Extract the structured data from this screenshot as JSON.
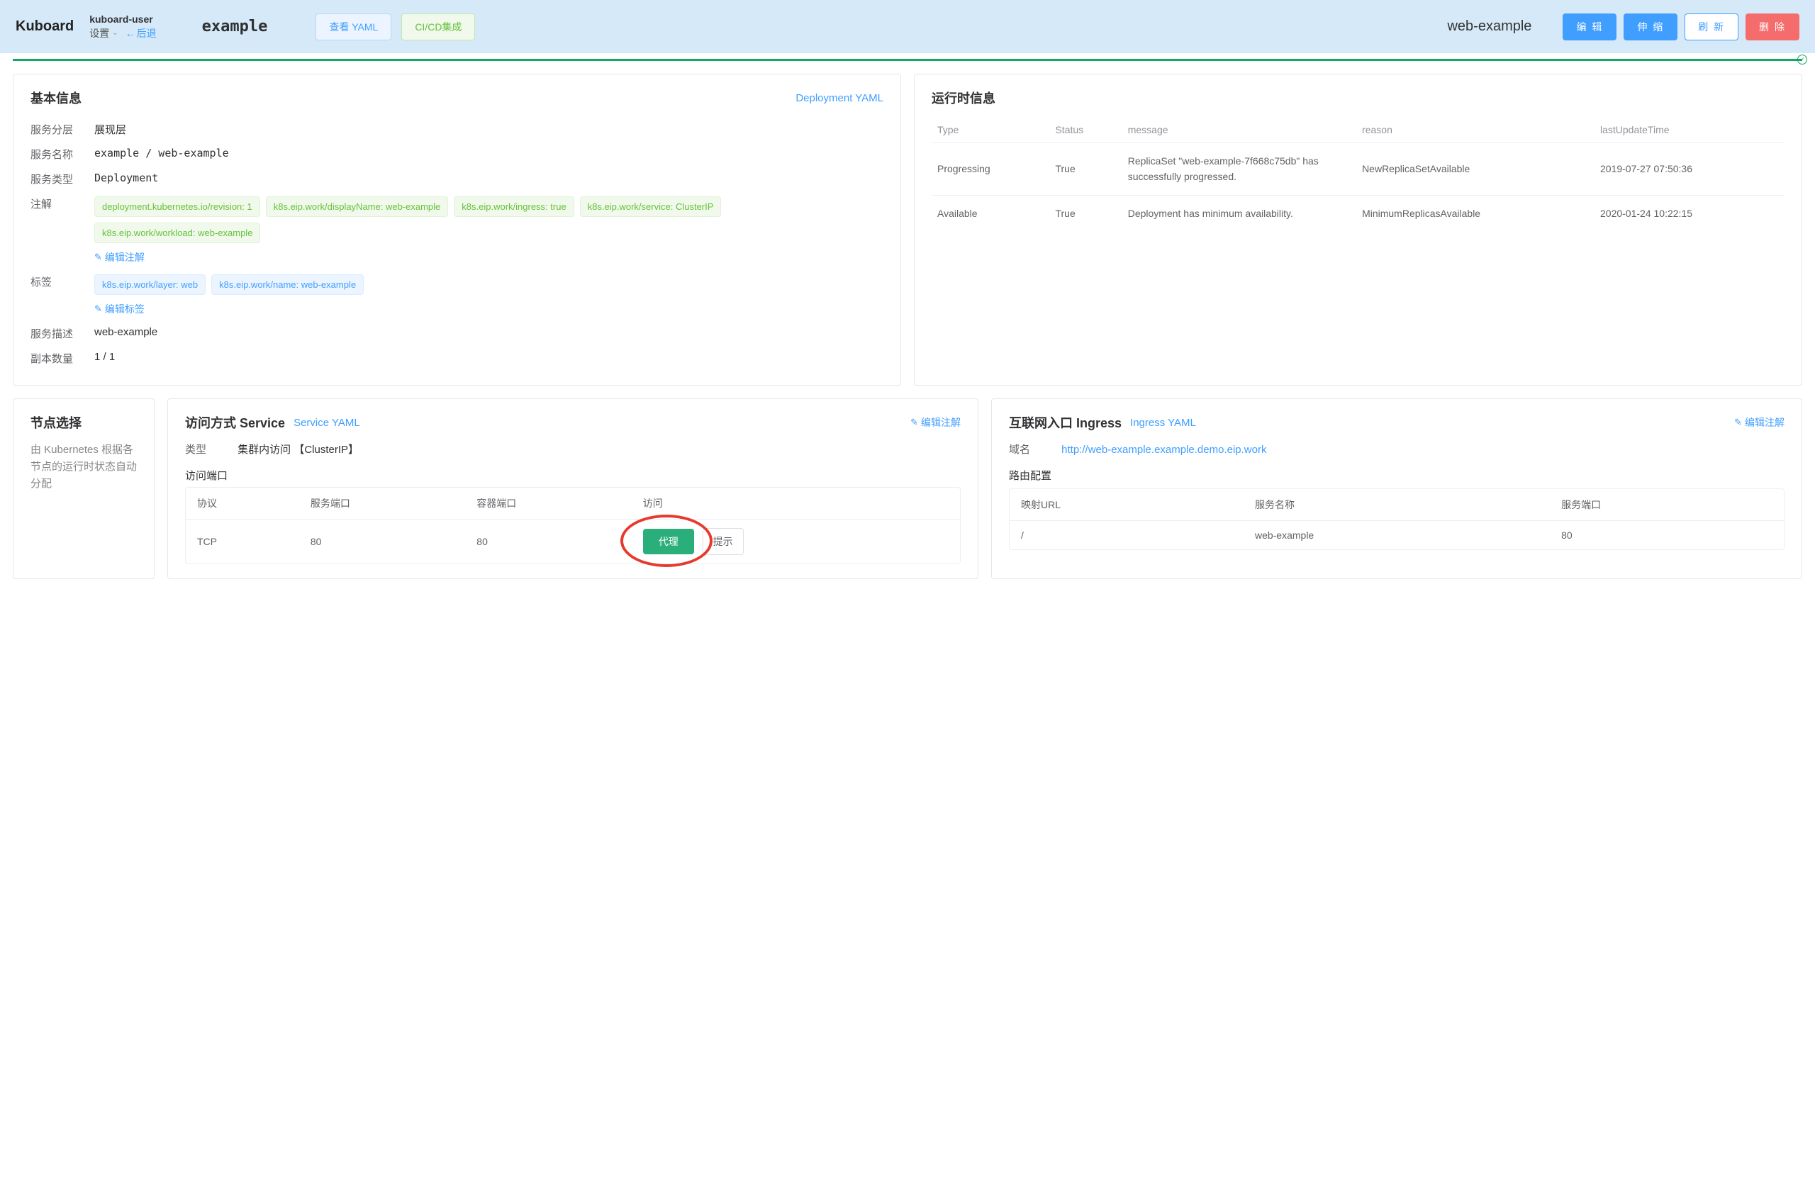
{
  "header": {
    "brand": "Kuboard",
    "user": "kuboard-user",
    "settings": "设置",
    "back": "后退",
    "namespace": "example",
    "view_yaml": "查看 YAML",
    "cicd": "CI/CD集成",
    "resource": "web-example",
    "edit": "编 辑",
    "scale": "伸 缩",
    "refresh": "刷 新",
    "delete": "删 除"
  },
  "basic": {
    "title": "基本信息",
    "yaml_link": "Deployment YAML",
    "layer_label": "服务分层",
    "layer_value": "展现层",
    "name_label": "服务名称",
    "name_value": "example / web-example",
    "type_label": "服务类型",
    "type_value": "Deployment",
    "anno_label": "注解",
    "annotations": [
      "deployment.kubernetes.io/revision: 1",
      "k8s.eip.work/displayName: web-example",
      "k8s.eip.work/ingress: true",
      "k8s.eip.work/service: ClusterIP",
      "k8s.eip.work/workload: web-example"
    ],
    "edit_anno": "编辑注解",
    "label_label": "标签",
    "labels": [
      "k8s.eip.work/layer: web",
      "k8s.eip.work/name: web-example"
    ],
    "edit_labels": "编辑标签",
    "desc_label": "服务描述",
    "desc_value": "web-example",
    "replica_label": "副本数量",
    "replica_value": "1 / 1"
  },
  "runtime": {
    "title": "运行时信息",
    "cols": {
      "type": "Type",
      "status": "Status",
      "message": "message",
      "reason": "reason",
      "time": "lastUpdateTime"
    },
    "rows": [
      {
        "type": "Progressing",
        "status": "True",
        "message": "ReplicaSet \"web-example-7f668c75db\" has successfully progressed.",
        "reason": "NewReplicaSetAvailable",
        "time": "2019-07-27 07:50:36"
      },
      {
        "type": "Available",
        "status": "True",
        "message": "Deployment has minimum availability.",
        "reason": "MinimumReplicasAvailable",
        "time": "2020-01-24 10:22:15"
      }
    ]
  },
  "node": {
    "title": "节点选择",
    "desc": "由 Kubernetes 根据各节点的运行时状态自动分配"
  },
  "service": {
    "title": "访问方式 Service",
    "yaml_link": "Service YAML",
    "edit_anno": "编辑注解",
    "type_label": "类型",
    "type_value": "集群内访问 【ClusterIP】",
    "ports_label": "访问端口",
    "port_cols": {
      "proto": "协议",
      "sport": "服务端口",
      "cport": "容器端口",
      "access": "访问"
    },
    "port_row": {
      "proto": "TCP",
      "sport": "80",
      "cport": "80",
      "proxy": "代理",
      "hint": "提示"
    }
  },
  "ingress": {
    "title": "互联网入口 Ingress",
    "yaml_link": "Ingress YAML",
    "edit_anno": "编辑注解",
    "domain_label": "域名",
    "domain_value": "http://web-example.example.demo.eip.work",
    "route_label": "路由配置",
    "route_cols": {
      "url": "映射URL",
      "svc": "服务名称",
      "port": "服务端口"
    },
    "route_row": {
      "url": "/",
      "svc": "web-example",
      "port": "80"
    }
  }
}
